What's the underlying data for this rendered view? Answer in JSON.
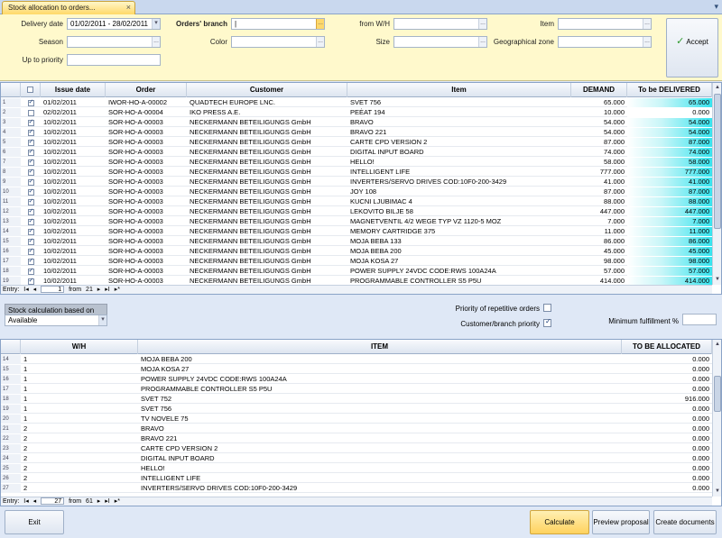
{
  "window": {
    "tab_title": "Stock allocation to orders...",
    "close_glyph": "×",
    "menu_glyph": "▾"
  },
  "filters": {
    "delivery_date_label": "Delivery date",
    "delivery_date_value": "01/02/2011 - 28/02/2011",
    "orders_branch_label": "Orders' branch",
    "orders_branch_value": "|",
    "from_wh_label": "from W/H",
    "item_label": "Item",
    "season_label": "Season",
    "color_label": "Color",
    "size_label": "Size",
    "geo_zone_label": "Geographical zone",
    "up_to_priority_label": "Up to priority",
    "ellipsis": "...",
    "dropdown_glyph": "▾"
  },
  "accept_label": "Accept",
  "accept_glyph": "✓",
  "orders_grid": {
    "columns": {
      "issue_date": "Issue date",
      "order": "Order",
      "customer": "Customer",
      "item": "Item",
      "demand": "DEMAND",
      "to_be_delivered": "To be DELIVERED"
    },
    "rows": [
      {
        "n": "1",
        "checked": true,
        "date": "01/02/2011",
        "order": "IWOR-HO-A-00002",
        "customer": "QUADTECH EUROPE LNC.",
        "item": "SVET 756",
        "demand": "65.000",
        "deliver": "65.000"
      },
      {
        "n": "2",
        "checked": false,
        "date": "02/02/2011",
        "order": "SOR-HO-A-00004",
        "customer": "IKO PRESS A.E.",
        "item": "PEĖAT 194",
        "demand": "10.000",
        "deliver": "0.000"
      },
      {
        "n": "3",
        "checked": true,
        "date": "10/02/2011",
        "order": "SOR-HO-A-00003",
        "customer": "NECKERMANN BETEILIGUNGS GmbH",
        "item": "BRAVO",
        "demand": "54.000",
        "deliver": "54.000"
      },
      {
        "n": "4",
        "checked": true,
        "date": "10/02/2011",
        "order": "SOR-HO-A-00003",
        "customer": "NECKERMANN BETEILIGUNGS GmbH",
        "item": "BRAVO 221",
        "demand": "54.000",
        "deliver": "54.000"
      },
      {
        "n": "5",
        "checked": true,
        "date": "10/02/2011",
        "order": "SOR-HO-A-00003",
        "customer": "NECKERMANN BETEILIGUNGS GmbH",
        "item": "CARTE CPD VERSION 2",
        "demand": "87.000",
        "deliver": "87.000"
      },
      {
        "n": "6",
        "checked": true,
        "date": "10/02/2011",
        "order": "SOR-HO-A-00003",
        "customer": "NECKERMANN BETEILIGUNGS GmbH",
        "item": "DIGITAL INPUT BOARD",
        "demand": "74.000",
        "deliver": "74.000"
      },
      {
        "n": "7",
        "checked": true,
        "date": "10/02/2011",
        "order": "SOR-HO-A-00003",
        "customer": "NECKERMANN BETEILIGUNGS GmbH",
        "item": "HELLO!",
        "demand": "58.000",
        "deliver": "58.000"
      },
      {
        "n": "8",
        "checked": true,
        "date": "10/02/2011",
        "order": "SOR-HO-A-00003",
        "customer": "NECKERMANN BETEILIGUNGS GmbH",
        "item": "INTELLIGENT LIFE",
        "demand": "777.000",
        "deliver": "777.000"
      },
      {
        "n": "9",
        "checked": true,
        "date": "10/02/2011",
        "order": "SOR-HO-A-00003",
        "customer": "NECKERMANN BETEILIGUNGS GmbH",
        "item": "INVERTERS/SERVO DRIVES COD:10F0-200-3429",
        "demand": "41.000",
        "deliver": "41.000"
      },
      {
        "n": "10",
        "checked": true,
        "date": "10/02/2011",
        "order": "SOR-HO-A-00003",
        "customer": "NECKERMANN BETEILIGUNGS GmbH",
        "item": "JOY 108",
        "demand": "87.000",
        "deliver": "87.000"
      },
      {
        "n": "11",
        "checked": true,
        "date": "10/02/2011",
        "order": "SOR-HO-A-00003",
        "customer": "NECKERMANN BETEILIGUNGS GmbH",
        "item": "KUCNI LJUBIMAC 4",
        "demand": "88.000",
        "deliver": "88.000"
      },
      {
        "n": "12",
        "checked": true,
        "date": "10/02/2011",
        "order": "SOR-HO-A-00003",
        "customer": "NECKERMANN BETEILIGUNGS GmbH",
        "item": "LEKOVITO BILJE 58",
        "demand": "447.000",
        "deliver": "447.000"
      },
      {
        "n": "13",
        "checked": true,
        "date": "10/02/2011",
        "order": "SOR-HO-A-00003",
        "customer": "NECKERMANN BETEILIGUNGS GmbH",
        "item": "MAGNETVENTIL 4/2 WEGE TYP VZ 1120-5 MOZ",
        "demand": "7.000",
        "deliver": "7.000"
      },
      {
        "n": "14",
        "checked": true,
        "date": "10/02/2011",
        "order": "SOR-HO-A-00003",
        "customer": "NECKERMANN BETEILIGUNGS GmbH",
        "item": "MEMORY CARTRIDGE 375",
        "demand": "11.000",
        "deliver": "11.000"
      },
      {
        "n": "15",
        "checked": true,
        "date": "10/02/2011",
        "order": "SOR-HO-A-00003",
        "customer": "NECKERMANN BETEILIGUNGS GmbH",
        "item": "MOJA BEBA 133",
        "demand": "86.000",
        "deliver": "86.000"
      },
      {
        "n": "16",
        "checked": true,
        "date": "10/02/2011",
        "order": "SOR-HO-A-00003",
        "customer": "NECKERMANN BETEILIGUNGS GmbH",
        "item": "MOJA BEBA 200",
        "demand": "45.000",
        "deliver": "45.000"
      },
      {
        "n": "17",
        "checked": true,
        "date": "10/02/2011",
        "order": "SOR-HO-A-00003",
        "customer": "NECKERMANN BETEILIGUNGS GmbH",
        "item": "MOJA KOSA 27",
        "demand": "98.000",
        "deliver": "98.000"
      },
      {
        "n": "18",
        "checked": true,
        "date": "10/02/2011",
        "order": "SOR-HO-A-00003",
        "customer": "NECKERMANN BETEILIGUNGS GmbH",
        "item": "POWER SUPPLY 24VDC CODE:RWS 100A24A",
        "demand": "57.000",
        "deliver": "57.000"
      },
      {
        "n": "19",
        "checked": true,
        "date": "10/02/2011",
        "order": "SOR-HO-A-00003",
        "customer": "NECKERMANN BETEILIGUNGS GmbH",
        "item": "PROGRAMMABLE CONTROLLER S5 P5U",
        "demand": "414.000",
        "deliver": "414.000"
      }
    ],
    "pager": {
      "entry": "Entry:",
      "from": "from",
      "total": "21",
      "current": "1",
      "first": "I◂",
      "prev": "◂",
      "next": "▸",
      "last": "▸I",
      "new": "▸*"
    }
  },
  "middle": {
    "stock_calc_label": "Stock calculation based on",
    "stock_calc_value": "Available",
    "priority_repetitive_label": "Priority of repetitive orders",
    "priority_repetitive_checked": false,
    "customer_branch_priority_label": "Customer/branch priority",
    "customer_branch_priority_checked": true,
    "min_fulfillment_label": "Minimum fulfillment %"
  },
  "alloc_grid": {
    "columns": {
      "wh": "W/H",
      "item": "ITEM",
      "to_be_allocated": "TO BE ALLOCATED"
    },
    "rows": [
      {
        "n": "14",
        "wh": "1",
        "item": "MOJA BEBA 200",
        "value": "0.000"
      },
      {
        "n": "15",
        "wh": "1",
        "item": "MOJA KOSA 27",
        "value": "0.000"
      },
      {
        "n": "16",
        "wh": "1",
        "item": "POWER SUPPLY 24VDC CODE:RWS 100A24A",
        "value": "0.000"
      },
      {
        "n": "17",
        "wh": "1",
        "item": "PROGRAMMABLE CONTROLLER S5 P5U",
        "value": "0.000"
      },
      {
        "n": "18",
        "wh": "1",
        "item": "SVET 752",
        "value": "916.000"
      },
      {
        "n": "19",
        "wh": "1",
        "item": "SVET 756",
        "value": "0.000"
      },
      {
        "n": "20",
        "wh": "1",
        "item": "TV NOVELE 75",
        "value": "0.000"
      },
      {
        "n": "21",
        "wh": "2",
        "item": "BRAVO",
        "value": "0.000"
      },
      {
        "n": "22",
        "wh": "2",
        "item": "BRAVO 221",
        "value": "0.000"
      },
      {
        "n": "23",
        "wh": "2",
        "item": "CARTE CPD VERSION 2",
        "value": "0.000"
      },
      {
        "n": "24",
        "wh": "2",
        "item": "DIGITAL INPUT BOARD",
        "value": "0.000"
      },
      {
        "n": "25",
        "wh": "2",
        "item": "HELLO!",
        "value": "0.000"
      },
      {
        "n": "26",
        "wh": "2",
        "item": "INTELLIGENT LIFE",
        "value": "0.000"
      },
      {
        "n": "27",
        "wh": "2",
        "item": "INVERTERS/SERVO DRIVES COD:10F0-200-3429",
        "value": "0.000"
      }
    ],
    "pager": {
      "entry": "Entry:",
      "from": "from",
      "total": "61",
      "current": "27",
      "first": "I◂",
      "prev": "◂",
      "next": "▸",
      "last": "▸I",
      "new": "▸*"
    }
  },
  "buttons": {
    "exit": "Exit",
    "calculate": "Calculate proposal",
    "preview": "Preview proposal",
    "create": "Create documents"
  }
}
